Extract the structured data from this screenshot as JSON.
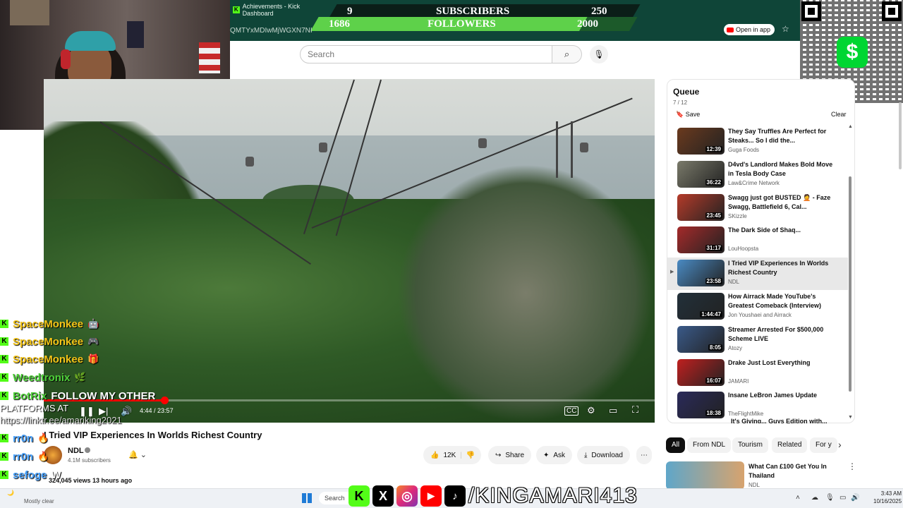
{
  "kick": {
    "tab_title": "Achievements - Kick Dashboard",
    "subscribers_label": "SUBSCRIBERS",
    "subscribers_current": "9",
    "subscribers_goal": "250",
    "followers_label": "FOLLOWERS",
    "followers_current": "1686",
    "followers_goal": "2000",
    "followers_progress": 0.843,
    "url_fragment": "QMTYxMDIwMjWGXN7NI"
  },
  "browser": {
    "open_in_app": "Open in app"
  },
  "search": {
    "placeholder": "Search"
  },
  "player": {
    "time_current": "4:44",
    "time_total": "23:57",
    "progress": 0.198
  },
  "video": {
    "title": "I Tried VIP Experiences In Worlds Richest Country",
    "channel": "NDL",
    "subscribers": "4.1M subscribers",
    "likes": "12K",
    "share": "Share",
    "ask": "Ask",
    "download": "Download",
    "views": "324,045 views  13 hours ago"
  },
  "queue": {
    "title": "Queue",
    "count": "7 / 12",
    "save": "Save",
    "clear": "Clear",
    "items": [
      {
        "title": "They Say Truffles Are Perfect for Steaks... So I did the...",
        "channel": "Guga Foods",
        "duration": "12:39",
        "color": "#6b3a1e"
      },
      {
        "title": "D4vd's Landlord Makes Bold Move in Tesla Body Case",
        "channel": "Law&Crime Network",
        "duration": "36:22",
        "color": "#7a7a6a"
      },
      {
        "title": "Swagg just got BUSTED 🤦 - Faze Swagg, Battlefield 6, Cal...",
        "channel": "SKizzle",
        "duration": "23:45",
        "color": "#b53b2a"
      },
      {
        "title": "The Dark Side of Shaq...",
        "channel": "LouHoopsta",
        "duration": "31:17",
        "color": "#a52a2a"
      },
      {
        "title": "I Tried VIP Experiences In Worlds Richest Country",
        "channel": "NDL",
        "duration": "23:58",
        "color": "#4a8bc4",
        "active": true
      },
      {
        "title": "How Airrack Made YouTube's Greatest Comeback (Interview)",
        "channel": "Jon Youshaei and Airrack",
        "duration": "1:44:47",
        "color": "#22303a"
      },
      {
        "title": "Streamer Arrested For $500,000 Scheme LIVE",
        "channel": "Atozy",
        "duration": "8:05",
        "color": "#3a5a8a"
      },
      {
        "title": "Drake Just Lost Everything",
        "channel": "JAMARI",
        "duration": "16:07",
        "color": "#c0201f"
      },
      {
        "title": "Insane LeBron James Update",
        "channel": "TheFlightMike",
        "duration": "18:38",
        "color": "#2a2a5a"
      }
    ],
    "partial_item": "It's Giving... Guys Edition with..."
  },
  "chips": [
    "All",
    "From NDL",
    "Tourism",
    "Related",
    "For y"
  ],
  "recommendation": {
    "title": "What Can £100 Get You In Thailand",
    "channel": "NDL"
  },
  "chat": [
    {
      "user": "SpaceMonkee",
      "color": "#f5c518",
      "emote": "🤖"
    },
    {
      "user": "SpaceMonkee",
      "color": "#f5c518",
      "emote": "🎮"
    },
    {
      "user": "SpaceMonkee",
      "color": "#f5c518",
      "emote": "🎁"
    },
    {
      "user": "Weedtronix",
      "color": "#4fd13a",
      "emote": "🌿"
    },
    {
      "user": "BotRix",
      "color": "#4fd13a",
      "message": "FOLLOW MY OTHER"
    },
    {
      "user": "rr0n",
      "color": "#4aa3ff",
      "emote": "🔥"
    },
    {
      "user": "rr0n",
      "color": "#4aa3ff",
      "emote": "🔥"
    },
    {
      "user": "sefoge",
      "color": "#4aa3ff",
      "message": "W"
    }
  ],
  "chat_fragments": {
    "platforms": "PLATFORMS AT",
    "link": "https://linktr.ee/amariking2021"
  },
  "taskbar": {
    "weather_sub": "Mostly clear",
    "search": "Search",
    "time": "3:43 AM",
    "date": "10/16/2025"
  },
  "socials": {
    "handle": "/KINGAMARI413"
  }
}
